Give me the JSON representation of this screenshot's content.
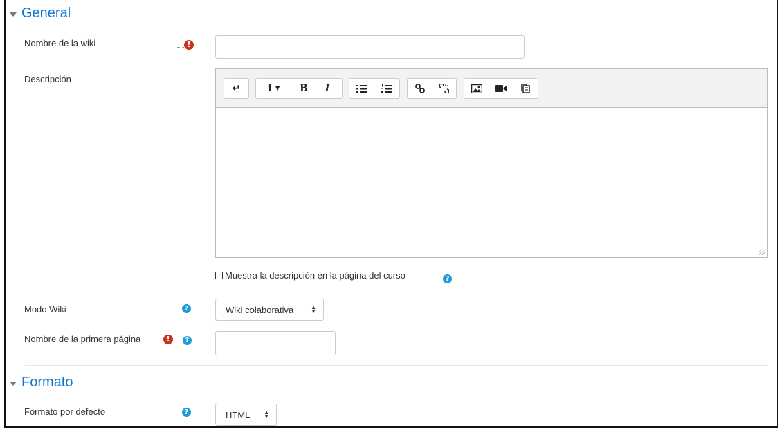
{
  "general": {
    "title": "General",
    "wiki_name_label": "Nombre de la wiki",
    "wiki_name_value": "",
    "description_label": "Descripción",
    "show_description_label": "Muestra la descripción en la página del curso",
    "show_description_checked": false,
    "mode_label": "Modo Wiki",
    "mode_value": "Wiki colaborativa",
    "first_page_label": "Nombre de la primera página",
    "first_page_value": ""
  },
  "toolbar": {
    "icons": [
      "collapse-icon",
      "info-icon",
      "bold-icon",
      "italic-icon",
      "unordered-list-icon",
      "ordered-list-icon",
      "link-icon",
      "unlink-icon",
      "image-icon",
      "video-icon",
      "manage-files-icon"
    ]
  },
  "format": {
    "title": "Formato",
    "default_format_label": "Formato por defecto",
    "default_format_value": "HTML"
  },
  "colors": {
    "section_title": "#1177d1",
    "required": "#ca3120",
    "help": "#1f9ad8"
  }
}
